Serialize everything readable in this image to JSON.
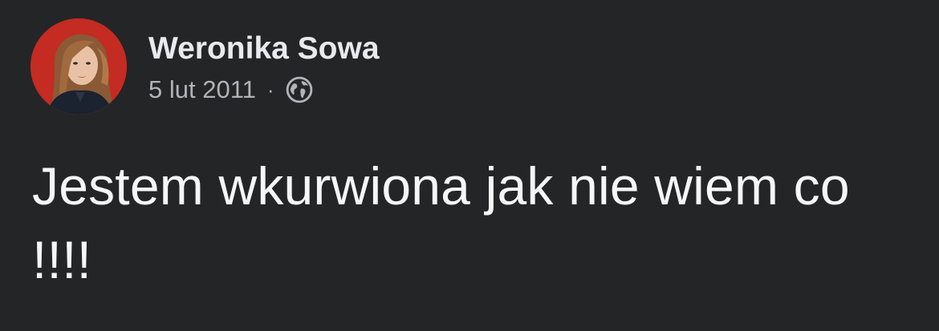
{
  "post": {
    "author": "Weronika Sowa",
    "date": "5 lut 2011",
    "separator": "·",
    "privacy_icon": "globe-icon",
    "text": "Jestem wkurwiona jak nie wiem co !!!!"
  },
  "colors": {
    "background": "#242526",
    "author_text": "#e9eaee",
    "meta_text": "#b0b3b8",
    "body_text": "#f5f6f8",
    "avatar_bg": "#c42b22"
  }
}
